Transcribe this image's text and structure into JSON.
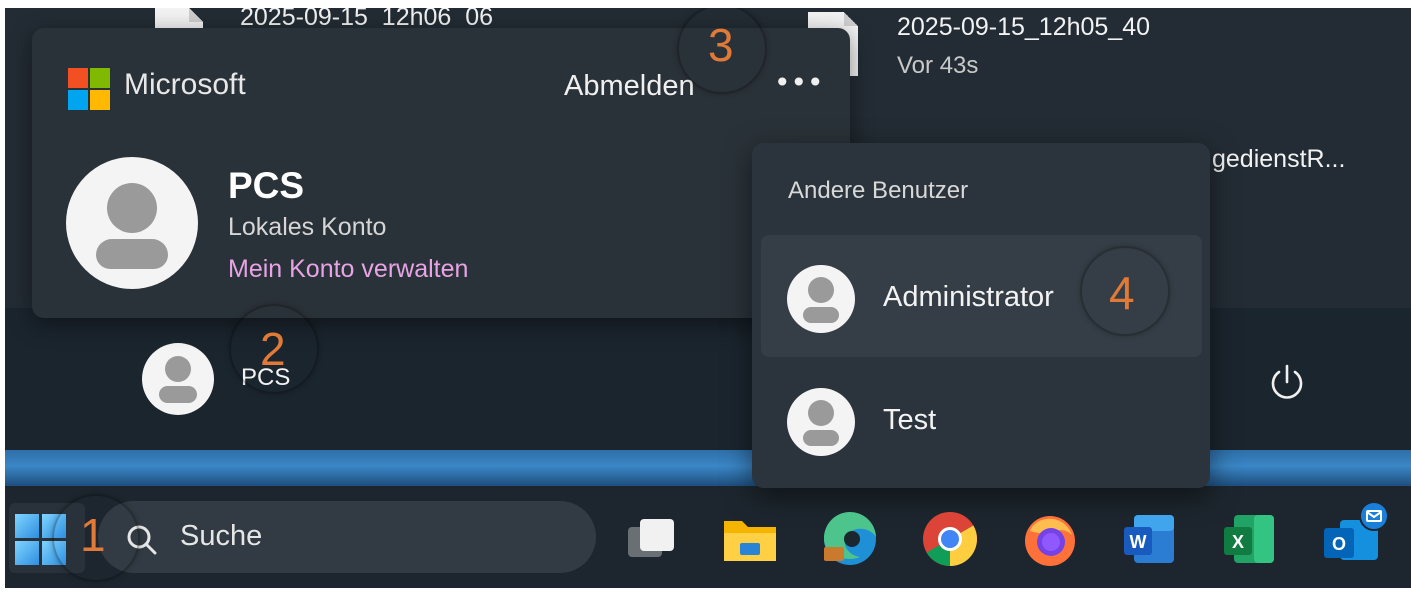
{
  "recent_files": [
    {
      "name": "2025-09-15_12h06_06",
      "time": ""
    },
    {
      "name": "2025-09-15_12h05_40",
      "time": "Vor 43s"
    },
    {
      "name": "gedienstR...",
      "time": ""
    }
  ],
  "account_card": {
    "brand": "Microsoft",
    "signout_label": "Abmelden",
    "more_label": "•••",
    "user_name": "PCS",
    "account_type": "Lokales Konto",
    "manage_link": "Mein Konto verwalten"
  },
  "start_footer": {
    "user_label": "PCS"
  },
  "other_users": {
    "title": "Andere Benutzer",
    "users": [
      {
        "name": "Administrator"
      },
      {
        "name": "Test"
      }
    ]
  },
  "taskbar": {
    "search_placeholder": "Suche",
    "apps": [
      "task-view",
      "file-explorer",
      "microsoft-edge",
      "google-chrome",
      "firefox",
      "word",
      "excel",
      "outlook"
    ]
  },
  "annotations": [
    "1",
    "2",
    "3",
    "4"
  ],
  "colors": {
    "accent_link": "#e7a4e4",
    "annotation": "#e27a37",
    "ms_red": "#f25022",
    "ms_green": "#7fba00",
    "ms_blue": "#00a4ef",
    "ms_yellow": "#ffb900"
  }
}
